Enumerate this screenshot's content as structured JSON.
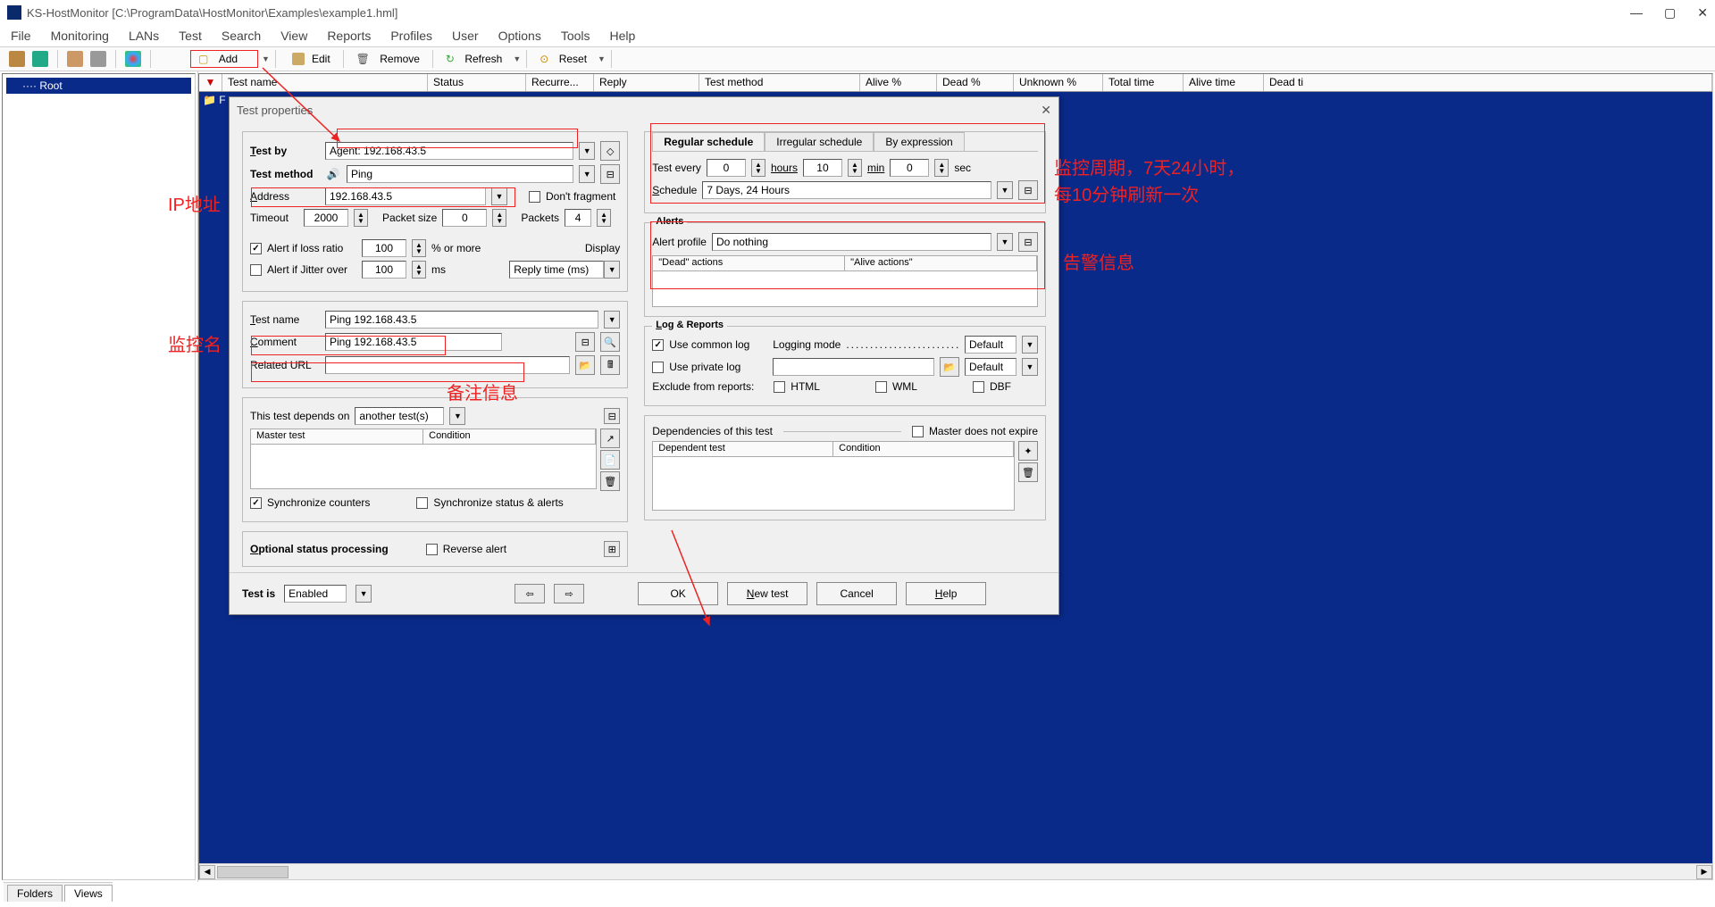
{
  "window": {
    "title": "KS-HostMonitor  [C:\\ProgramData\\HostMonitor\\Examples\\example1.hml]",
    "min": "—",
    "max": "▢",
    "close": "✕"
  },
  "menu": [
    "File",
    "Monitoring",
    "LANs",
    "Test",
    "Search",
    "View",
    "Reports",
    "Profiles",
    "User",
    "Options",
    "Tools",
    "Help"
  ],
  "toolbar": {
    "add": "Add",
    "edit": "Edit",
    "remove": "Remove",
    "refresh": "Refresh",
    "reset": "Reset"
  },
  "tree": {
    "root": "Root"
  },
  "grid_headers": [
    "Test name",
    "Status",
    "Recurre...",
    "Reply",
    "Test method",
    "Alive %",
    "Dead %",
    "Unknown %",
    "Total time",
    "Alive time",
    "Dead ti"
  ],
  "tabs_bottom": {
    "folders": "Folders",
    "views": "Views"
  },
  "dialog": {
    "title": "Test properties",
    "test_by_lbl": "Test by",
    "test_by_val": "Agent: 192.168.43.5",
    "test_method_lbl": "Test method",
    "test_method_val": "Ping",
    "address_lbl": "Address",
    "address_val": "192.168.43.5",
    "dont_fragment": "Don't fragment",
    "timeout_lbl": "Timeout",
    "timeout_val": "2000",
    "packet_size_lbl": "Packet size",
    "packet_size_val": "0",
    "packets_lbl": "Packets",
    "packets_val": "4",
    "alert_loss_lbl": "Alert if loss ratio",
    "alert_loss_val": "100",
    "pct_more": "%  or more",
    "display_lbl": "Display",
    "alert_jitter_lbl": "Alert if Jitter over",
    "alert_jitter_val": "100",
    "ms": "ms",
    "display_val": "Reply time (ms)",
    "test_name_lbl": "Test name",
    "test_name_val": "Ping 192.168.43.5",
    "comment_lbl": "Comment",
    "comment_val": "Ping 192.168.43.5",
    "related_url_lbl": "Related URL",
    "depends_lbl": "This test depends on",
    "depends_val": "another test(s)",
    "master_test": "Master test",
    "condition": "Condition",
    "sync_counters": "Synchronize counters",
    "sync_status": "Synchronize status & alerts",
    "opt_status": "Optional status processing",
    "reverse": "Reverse alert",
    "test_is": "Test is",
    "test_is_val": "Enabled",
    "sched_tabs": {
      "regular": "Regular schedule",
      "irregular": "Irregular schedule",
      "byexpr": "By expression"
    },
    "test_every": "Test every",
    "hours": "0",
    "hours_u": "hours",
    "min": "10",
    "min_u": "min",
    "sec": "0",
    "sec_u": "sec",
    "schedule_lbl": "Schedule",
    "schedule_val": "7 Days, 24 Hours",
    "alerts_lbl": "Alerts",
    "alert_profile_lbl": "Alert profile",
    "alert_profile_val": "Do nothing",
    "dead_actions": "\"Dead\" actions",
    "alive_actions": "\"Alive actions\"",
    "log_lbl": "Log & Reports",
    "use_common": "Use common log",
    "logging_mode": "Logging mode",
    "default": "Default",
    "use_private": "Use private log",
    "exclude": "Exclude from reports:",
    "html": "HTML",
    "wml": "WML",
    "dbf": "DBF",
    "deps_of": "Dependencies of this test",
    "master_no_expire": "Master does not expire",
    "dependent": "Dependent test",
    "ok": "OK",
    "new_test": "New test",
    "cancel": "Cancel",
    "help": "Help"
  },
  "annotations": {
    "ip": "IP地址",
    "monitor_name": "监控名",
    "remark": "备注信息",
    "sched_desc1": "监控周期，7天24小时，",
    "sched_desc2": "每10分钟刷新一次",
    "alert_info": "告警信息"
  }
}
